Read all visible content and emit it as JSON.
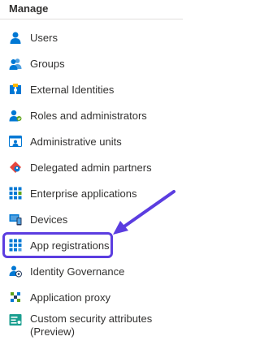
{
  "section": {
    "title": "Manage"
  },
  "menu": {
    "items": [
      {
        "label": "Users",
        "icon": "user-icon"
      },
      {
        "label": "Groups",
        "icon": "groups-icon"
      },
      {
        "label": "External Identities",
        "icon": "external-identities-icon"
      },
      {
        "label": "Roles and administrators",
        "icon": "roles-icon"
      },
      {
        "label": "Administrative units",
        "icon": "admin-units-icon"
      },
      {
        "label": "Delegated admin partners",
        "icon": "delegated-partners-icon"
      },
      {
        "label": "Enterprise applications",
        "icon": "enterprise-apps-icon"
      },
      {
        "label": "Devices",
        "icon": "devices-icon"
      },
      {
        "label": "App registrations",
        "icon": "app-registrations-icon"
      },
      {
        "label": "Identity Governance",
        "icon": "identity-governance-icon"
      },
      {
        "label": "Application proxy",
        "icon": "application-proxy-icon"
      },
      {
        "label": "Custom security attributes (Preview)",
        "icon": "custom-security-attributes-icon"
      }
    ]
  },
  "annotation": {
    "highlighted_item": "App registrations",
    "highlight_color": "#5b3de0"
  },
  "colors": {
    "text": "#323130",
    "azure_blue": "#0078d4",
    "divider": "#e1dfdd"
  }
}
